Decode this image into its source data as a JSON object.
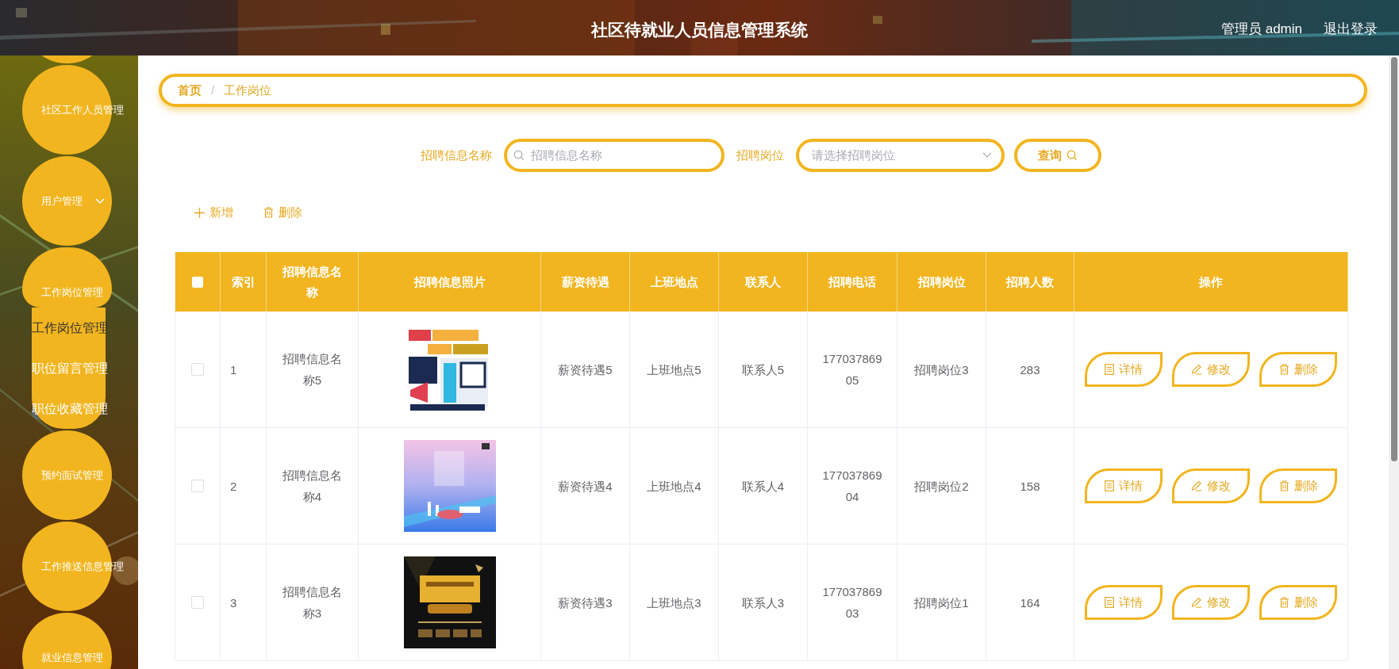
{
  "header": {
    "title": "社区待就业人员信息管理系统",
    "user": "管理员 admin",
    "logout": "退出登录"
  },
  "sidebar": {
    "items": [
      {
        "kind": "link",
        "label": "社区工作人员管理"
      },
      {
        "kind": "group",
        "label": "用户管理",
        "expanded": false
      },
      {
        "kind": "group",
        "label": "工作岗位管理",
        "expanded": true,
        "children": [
          {
            "label": "工作岗位管理",
            "selected": true
          },
          {
            "label": "职位留言管理",
            "selected": false
          },
          {
            "label": "职位收藏管理",
            "selected": false
          }
        ]
      },
      {
        "kind": "link",
        "label": "预约面试管理"
      },
      {
        "kind": "link",
        "label": "工作推送信息管理"
      },
      {
        "kind": "link",
        "label": "就业信息管理"
      }
    ]
  },
  "breadcrumb": {
    "separator": "/",
    "items": [
      {
        "label": "首页",
        "current": false
      },
      {
        "label": "工作岗位",
        "current": true
      }
    ]
  },
  "search": {
    "fields": [
      {
        "kind": "text",
        "label": "招聘信息名称",
        "placeholder": "招聘信息名称"
      },
      {
        "kind": "select",
        "label": "招聘岗位",
        "placeholder": "请选择招聘岗位"
      }
    ],
    "button": "查询"
  },
  "toolbar": [
    {
      "kind": "add",
      "label": "新增"
    },
    {
      "kind": "delete",
      "label": "删除"
    }
  ],
  "table": {
    "select_all": {
      "checked": false
    },
    "columns": [
      "索引",
      "招聘信息名称",
      "招聘信息照片",
      "薪资待遇",
      "上班地点",
      "联系人",
      "招聘电话",
      "招聘岗位",
      "招聘人数",
      "操作"
    ],
    "rows": [
      {
        "checked": false,
        "index": "1",
        "name": "招聘信息名称5",
        "salary": "薪资待遇5",
        "location": "上班地点5",
        "contact": "联系人5",
        "phone": "17703786905",
        "position": "招聘岗位3",
        "count": "283",
        "actions": [
          {
            "kind": "detail",
            "label": "详情"
          },
          {
            "kind": "edit",
            "label": "修改"
          },
          {
            "kind": "delete",
            "label": "删除"
          }
        ]
      },
      {
        "checked": false,
        "index": "2",
        "name": "招聘信息名称4",
        "salary": "薪资待遇4",
        "location": "上班地点4",
        "contact": "联系人4",
        "phone": "17703786904",
        "position": "招聘岗位2",
        "count": "158",
        "actions": [
          {
            "kind": "detail",
            "label": "详情"
          },
          {
            "kind": "edit",
            "label": "修改"
          },
          {
            "kind": "delete",
            "label": "删除"
          }
        ]
      },
      {
        "checked": false,
        "index": "3",
        "name": "招聘信息名称3",
        "salary": "薪资待遇3",
        "location": "上班地点3",
        "contact": "联系人3",
        "phone": "17703786903",
        "position": "招聘岗位1",
        "count": "164",
        "actions": [
          {
            "kind": "detail",
            "label": "详情"
          },
          {
            "kind": "edit",
            "label": "修改"
          },
          {
            "kind": "delete",
            "label": "删除"
          }
        ]
      }
    ]
  }
}
